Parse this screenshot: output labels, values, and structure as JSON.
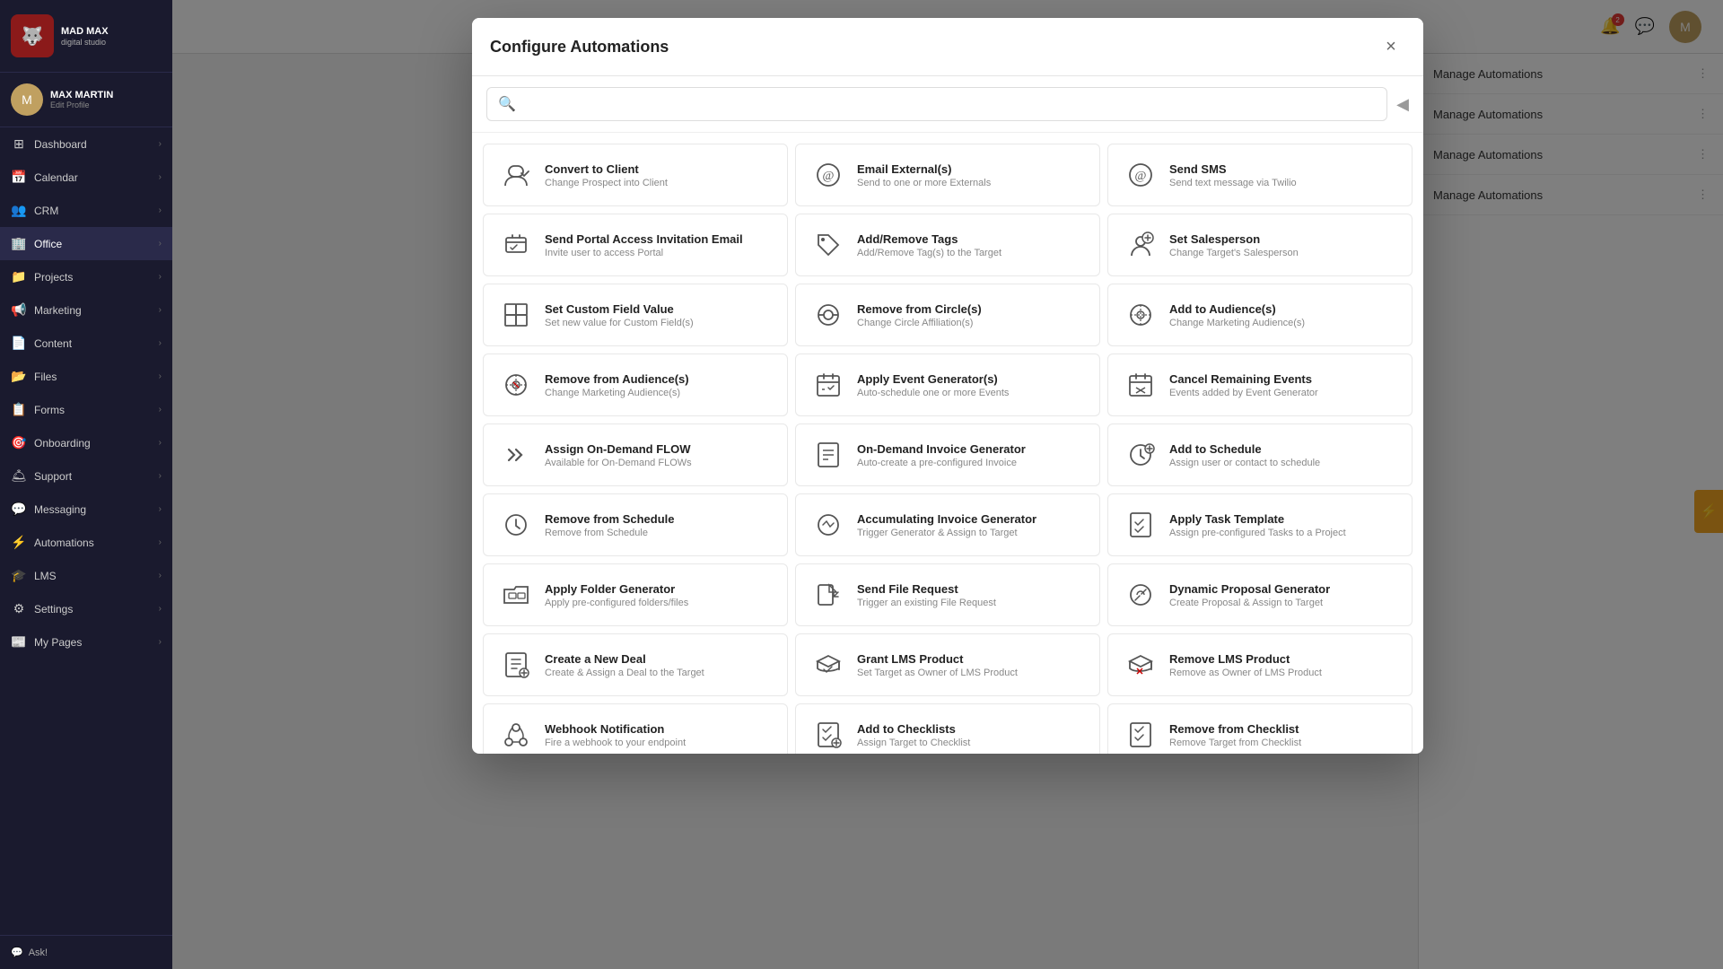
{
  "app": {
    "name": "MAD MAX",
    "sub": "digital studio"
  },
  "user": {
    "name": "MAX MARTIN",
    "edit_label": "Edit Profile"
  },
  "sidebar": {
    "items": [
      {
        "id": "dashboard",
        "label": "Dashboard",
        "icon": "⊞",
        "has_arrow": true
      },
      {
        "id": "calendar",
        "label": "Calendar",
        "icon": "📅",
        "has_arrow": true
      },
      {
        "id": "crm",
        "label": "CRM",
        "icon": "👥",
        "has_arrow": true
      },
      {
        "id": "office",
        "label": "Office",
        "icon": "🏢",
        "has_arrow": true,
        "active": true
      },
      {
        "id": "projects",
        "label": "Projects",
        "icon": "📁",
        "has_arrow": true
      },
      {
        "id": "marketing",
        "label": "Marketing",
        "icon": "📢",
        "has_arrow": true
      },
      {
        "id": "content",
        "label": "Content",
        "icon": "📄",
        "has_arrow": true
      },
      {
        "id": "files",
        "label": "Files",
        "icon": "📂",
        "has_arrow": true
      },
      {
        "id": "forms",
        "label": "Forms",
        "icon": "📋",
        "has_arrow": true
      },
      {
        "id": "onboarding",
        "label": "Onboarding",
        "icon": "🎯",
        "has_arrow": true
      },
      {
        "id": "support",
        "label": "Support",
        "icon": "🛎",
        "has_arrow": true
      },
      {
        "id": "messaging",
        "label": "Messaging",
        "icon": "💬",
        "has_arrow": true
      },
      {
        "id": "automations",
        "label": "Automations",
        "icon": "⚡",
        "has_arrow": true
      },
      {
        "id": "lms",
        "label": "LMS",
        "icon": "🎓",
        "has_arrow": true
      },
      {
        "id": "settings",
        "label": "Settings",
        "icon": "⚙",
        "has_arrow": true
      },
      {
        "id": "my-pages",
        "label": "My Pages",
        "icon": "📰",
        "has_arrow": true
      }
    ],
    "footer": {
      "ask_label": "Ask!"
    }
  },
  "modal": {
    "title": "Configure Automations",
    "close_label": "×",
    "search_placeholder": "",
    "back_icon": "◀",
    "automation_cards": [
      {
        "id": "convert-to-client",
        "title": "Convert to Client",
        "description": "Change Prospect into Client",
        "icon": "👤"
      },
      {
        "id": "email-externals",
        "title": "Email External(s)",
        "description": "Send to one or more Externals",
        "icon": "@"
      },
      {
        "id": "send-sms",
        "title": "Send SMS",
        "description": "Send text message via Twilio",
        "icon": "@"
      },
      {
        "id": "send-portal-access",
        "title": "Send Portal Access Invitation Email",
        "description": "Invite user to access Portal",
        "icon": "✉"
      },
      {
        "id": "add-remove-tags",
        "title": "Add/Remove Tags",
        "description": "Add/Remove Tag(s) to the Target",
        "icon": "🏷"
      },
      {
        "id": "set-salesperson",
        "title": "Set Salesperson",
        "description": "Change Target's Salesperson",
        "icon": "⚙"
      },
      {
        "id": "set-custom-field",
        "title": "Set Custom Field Value",
        "description": "Set new value for Custom Field(s)",
        "icon": "⊡"
      },
      {
        "id": "remove-from-circle",
        "title": "Remove from Circle(s)",
        "description": "Change Circle Affiliation(s)",
        "icon": "◎"
      },
      {
        "id": "add-to-audiences",
        "title": "Add to Audience(s)",
        "description": "Change Marketing Audience(s)",
        "icon": "🎯"
      },
      {
        "id": "remove-from-audiences",
        "title": "Remove from Audience(s)",
        "description": "Change Marketing Audience(s)",
        "icon": "🎯"
      },
      {
        "id": "apply-event-generator",
        "title": "Apply Event Generator(s)",
        "description": "Auto-schedule one or more Events",
        "icon": "📅"
      },
      {
        "id": "cancel-remaining-events",
        "title": "Cancel Remaining Events",
        "description": "Events added by Event Generator",
        "icon": "📅"
      },
      {
        "id": "assign-on-demand-flow",
        "title": "Assign On-Demand FLOW",
        "description": "Available for On-Demand FLOWs",
        "icon": "▶▶"
      },
      {
        "id": "on-demand-invoice",
        "title": "On-Demand Invoice Generator",
        "description": "Auto-create a pre-configured Invoice",
        "icon": "📄"
      },
      {
        "id": "add-to-schedule",
        "title": "Add to Schedule",
        "description": "Assign user or contact to schedule",
        "icon": "🕐"
      },
      {
        "id": "remove-from-schedule",
        "title": "Remove from Schedule",
        "description": "Remove from Schedule",
        "icon": "🕐"
      },
      {
        "id": "accumulating-invoice",
        "title": "Accumulating Invoice Generator",
        "description": "Trigger Generator & Assign to Target",
        "icon": "⚙"
      },
      {
        "id": "apply-task-template",
        "title": "Apply Task Template",
        "description": "Assign pre-configured Tasks to a Project",
        "icon": "✓"
      },
      {
        "id": "apply-folder-generator",
        "title": "Apply Folder Generator",
        "description": "Apply pre-configured folders/files",
        "icon": "📁"
      },
      {
        "id": "send-file-request",
        "title": "Send File Request",
        "description": "Trigger an existing File Request",
        "icon": "📤"
      },
      {
        "id": "dynamic-proposal-generator",
        "title": "Dynamic Proposal Generator",
        "description": "Create Proposal & Assign to Target",
        "icon": "⚙"
      },
      {
        "id": "create-new-deal",
        "title": "Create a New Deal",
        "description": "Create & Assign a Deal to the Target",
        "icon": "📝"
      },
      {
        "id": "grant-lms-product",
        "title": "Grant LMS Product",
        "description": "Set Target as Owner of LMS Product",
        "icon": "🎓"
      },
      {
        "id": "remove-lms-product",
        "title": "Remove LMS Product",
        "description": "Remove as Owner of LMS Product",
        "icon": "🎓"
      },
      {
        "id": "webhook-notification",
        "title": "Webhook Notification",
        "description": "Fire a webhook to your endpoint",
        "icon": "⚙"
      },
      {
        "id": "add-to-checklists",
        "title": "Add to Checklists",
        "description": "Assign Target to Checklist",
        "icon": "☑"
      },
      {
        "id": "remove-from-checklist",
        "title": "Remove from Checklist",
        "description": "Remove Target from Checklist",
        "icon": "☑"
      }
    ]
  },
  "topbar": {
    "notification_count": "2",
    "chat_icon": "💬",
    "bell_icon": "🔔"
  },
  "right_panel": {
    "rows": [
      {
        "label": "Manage Automations",
        "id": "row1"
      },
      {
        "label": "Manage Automations",
        "id": "row2"
      },
      {
        "label": "Manage Automations",
        "id": "row3"
      },
      {
        "label": "Manage Automations",
        "id": "row4"
      }
    ]
  },
  "icons": {
    "search": "🔍",
    "close": "✕",
    "back": "◀",
    "chevron_right": "›",
    "lightning": "⚡",
    "list_view": "≡",
    "card_view": "⊞"
  }
}
